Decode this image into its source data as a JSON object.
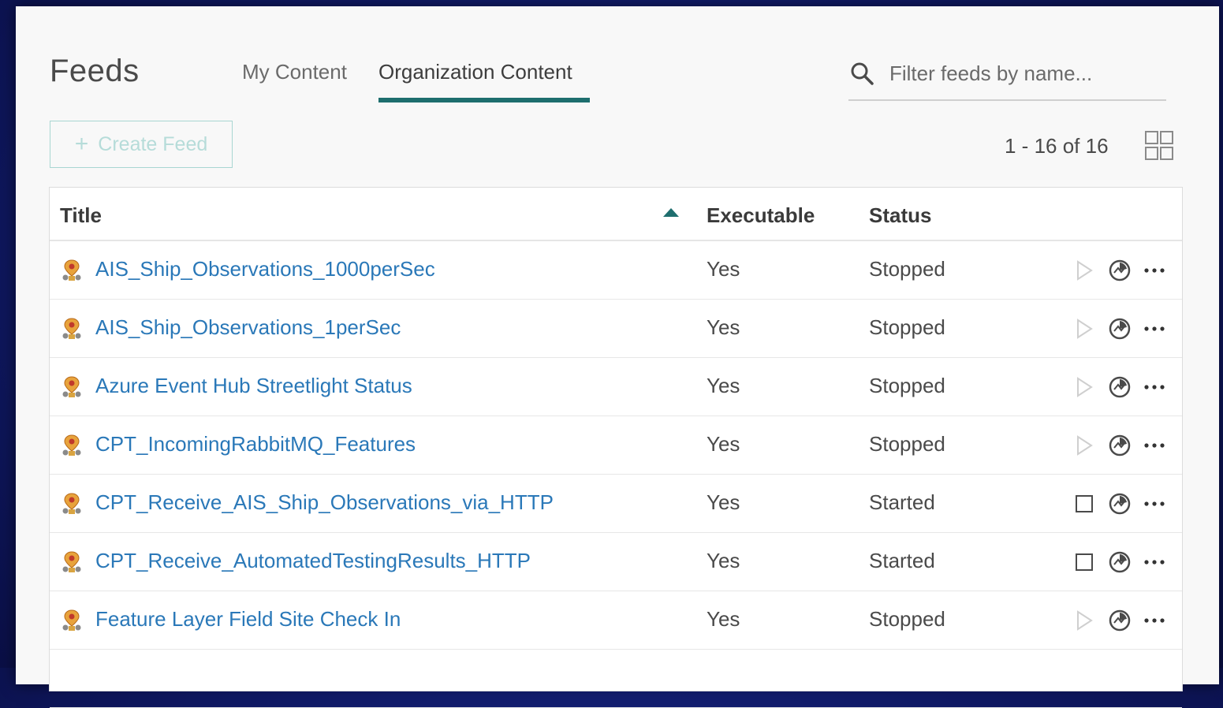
{
  "header": {
    "title": "Feeds",
    "tabs": [
      {
        "label": "My Content",
        "active": false
      },
      {
        "label": "Organization Content",
        "active": true
      }
    ],
    "search": {
      "placeholder": "Filter feeds by name..."
    }
  },
  "toolbar": {
    "create_label": "Create Feed",
    "count_label": "1 - 16 of 16"
  },
  "table": {
    "columns": [
      "Title",
      "Executable",
      "Status"
    ],
    "sort": {
      "column": "Title",
      "direction": "ascending"
    },
    "rows": [
      {
        "title": "AIS_Ship_Observations_1000perSec",
        "executable": "Yes",
        "status": "Stopped"
      },
      {
        "title": "AIS_Ship_Observations_1perSec",
        "executable": "Yes",
        "status": "Stopped"
      },
      {
        "title": "Azure Event Hub Streetlight Status",
        "executable": "Yes",
        "status": "Stopped"
      },
      {
        "title": "CPT_IncomingRabbitMQ_Features",
        "executable": "Yes",
        "status": "Stopped"
      },
      {
        "title": "CPT_Receive_AIS_Ship_Observations_via_HTTP",
        "executable": "Yes",
        "status": "Started"
      },
      {
        "title": "CPT_Receive_AutomatedTestingResults_HTTP",
        "executable": "Yes",
        "status": "Started"
      },
      {
        "title": "Feature Layer Field Site Check In",
        "executable": "Yes",
        "status": "Stopped"
      },
      {
        "title": "",
        "executable": "",
        "status": ""
      }
    ]
  },
  "icons": {
    "search": "search-icon",
    "grid": "grid-view-icon",
    "sort": "sort-ascending-icon",
    "feed": "feed-icon",
    "start": "play-icon",
    "stop": "stop-icon",
    "monitor": "monitor-icon",
    "more": "more-options-icon"
  },
  "colors": {
    "accent": "#1e6e6e",
    "link": "#2a78b8",
    "background": "#101a66"
  }
}
